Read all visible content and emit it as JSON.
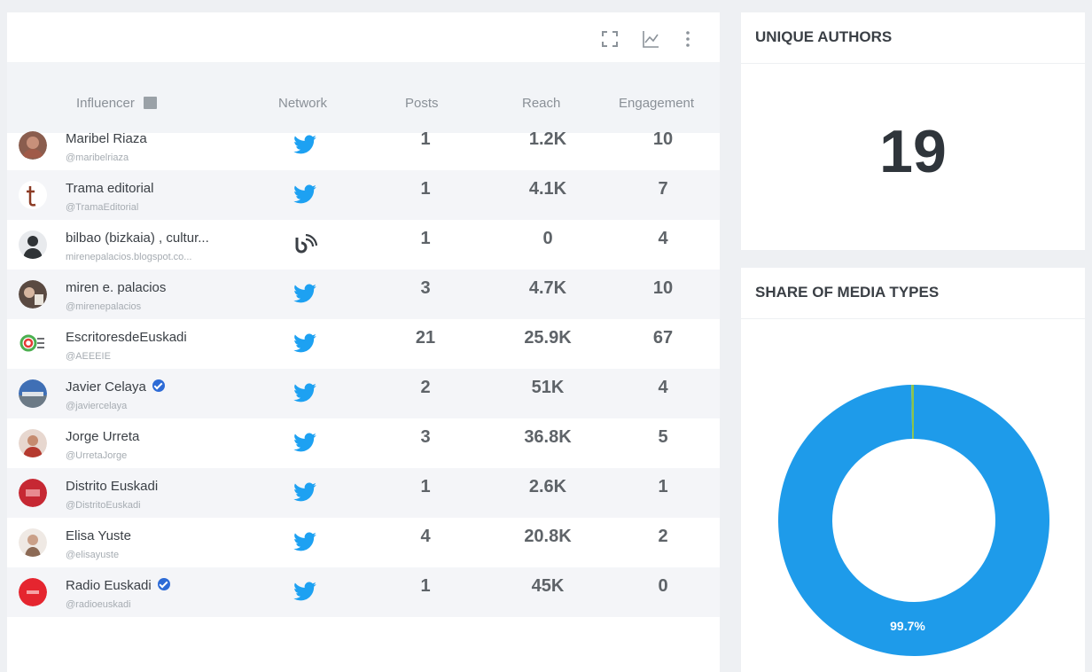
{
  "table": {
    "headers": {
      "influencer": "Influencer",
      "network": "Network",
      "posts": "Posts",
      "reach": "Reach",
      "engagement": "Engagement"
    },
    "rows": [
      {
        "name": "Maribel Riaza",
        "handle": "@maribelriaza",
        "network": "twitter-icon",
        "verified": false,
        "posts": "1",
        "reach": "1.2K",
        "engagement": "10"
      },
      {
        "name": "Trama editorial",
        "handle": "@TramaEditorial",
        "network": "twitter-icon",
        "verified": false,
        "posts": "1",
        "reach": "4.1K",
        "engagement": "7"
      },
      {
        "name": "bilbao (bizkaia) , cultur...",
        "handle": "mirenepalacios.blogspot.co...",
        "network": "blog-icon",
        "verified": false,
        "posts": "1",
        "reach": "0",
        "engagement": "4"
      },
      {
        "name": "miren e. palacios",
        "handle": "@mirenepalacios",
        "network": "twitter-icon",
        "verified": false,
        "posts": "3",
        "reach": "4.7K",
        "engagement": "10"
      },
      {
        "name": "EscritoresdeEuskadi",
        "handle": "@AEEEIE",
        "network": "twitter-icon",
        "verified": false,
        "posts": "21",
        "reach": "25.9K",
        "engagement": "67"
      },
      {
        "name": "Javier Celaya",
        "handle": "@javiercelaya",
        "network": "twitter-icon",
        "verified": true,
        "posts": "2",
        "reach": "51K",
        "engagement": "4"
      },
      {
        "name": "Jorge Urreta",
        "handle": "@UrretaJorge",
        "network": "twitter-icon",
        "verified": false,
        "posts": "3",
        "reach": "36.8K",
        "engagement": "5"
      },
      {
        "name": "Distrito Euskadi",
        "handle": "@DistritoEuskadi",
        "network": "twitter-icon",
        "verified": false,
        "posts": "1",
        "reach": "2.6K",
        "engagement": "1"
      },
      {
        "name": "Elisa Yuste",
        "handle": "@elisayuste",
        "network": "twitter-icon",
        "verified": false,
        "posts": "4",
        "reach": "20.8K",
        "engagement": "2"
      },
      {
        "name": "Radio Euskadi",
        "handle": "@radioeuskadi",
        "network": "twitter-icon",
        "verified": true,
        "posts": "1",
        "reach": "45K",
        "engagement": "0"
      }
    ]
  },
  "toolbar": {
    "icons": [
      "fullscreen-icon",
      "line-chart-icon",
      "more-vert-icon"
    ]
  },
  "unique_authors": {
    "title": "UNIQUE AUTHORS",
    "value": "19"
  },
  "media_types": {
    "title": "SHARE OF MEDIA TYPES",
    "label": "99.7%"
  },
  "colors": {
    "twitter": "#1da1f2",
    "donut_main": "#1e9bea",
    "donut_minor": "#8bc34a",
    "verified": "#2d6bd6"
  },
  "chart_data": {
    "type": "pie",
    "title": "SHARE OF MEDIA TYPES",
    "categories": [
      "",
      ""
    ],
    "values": [
      99.7,
      0.3
    ],
    "data_labels": [
      "99.7%",
      ""
    ]
  }
}
